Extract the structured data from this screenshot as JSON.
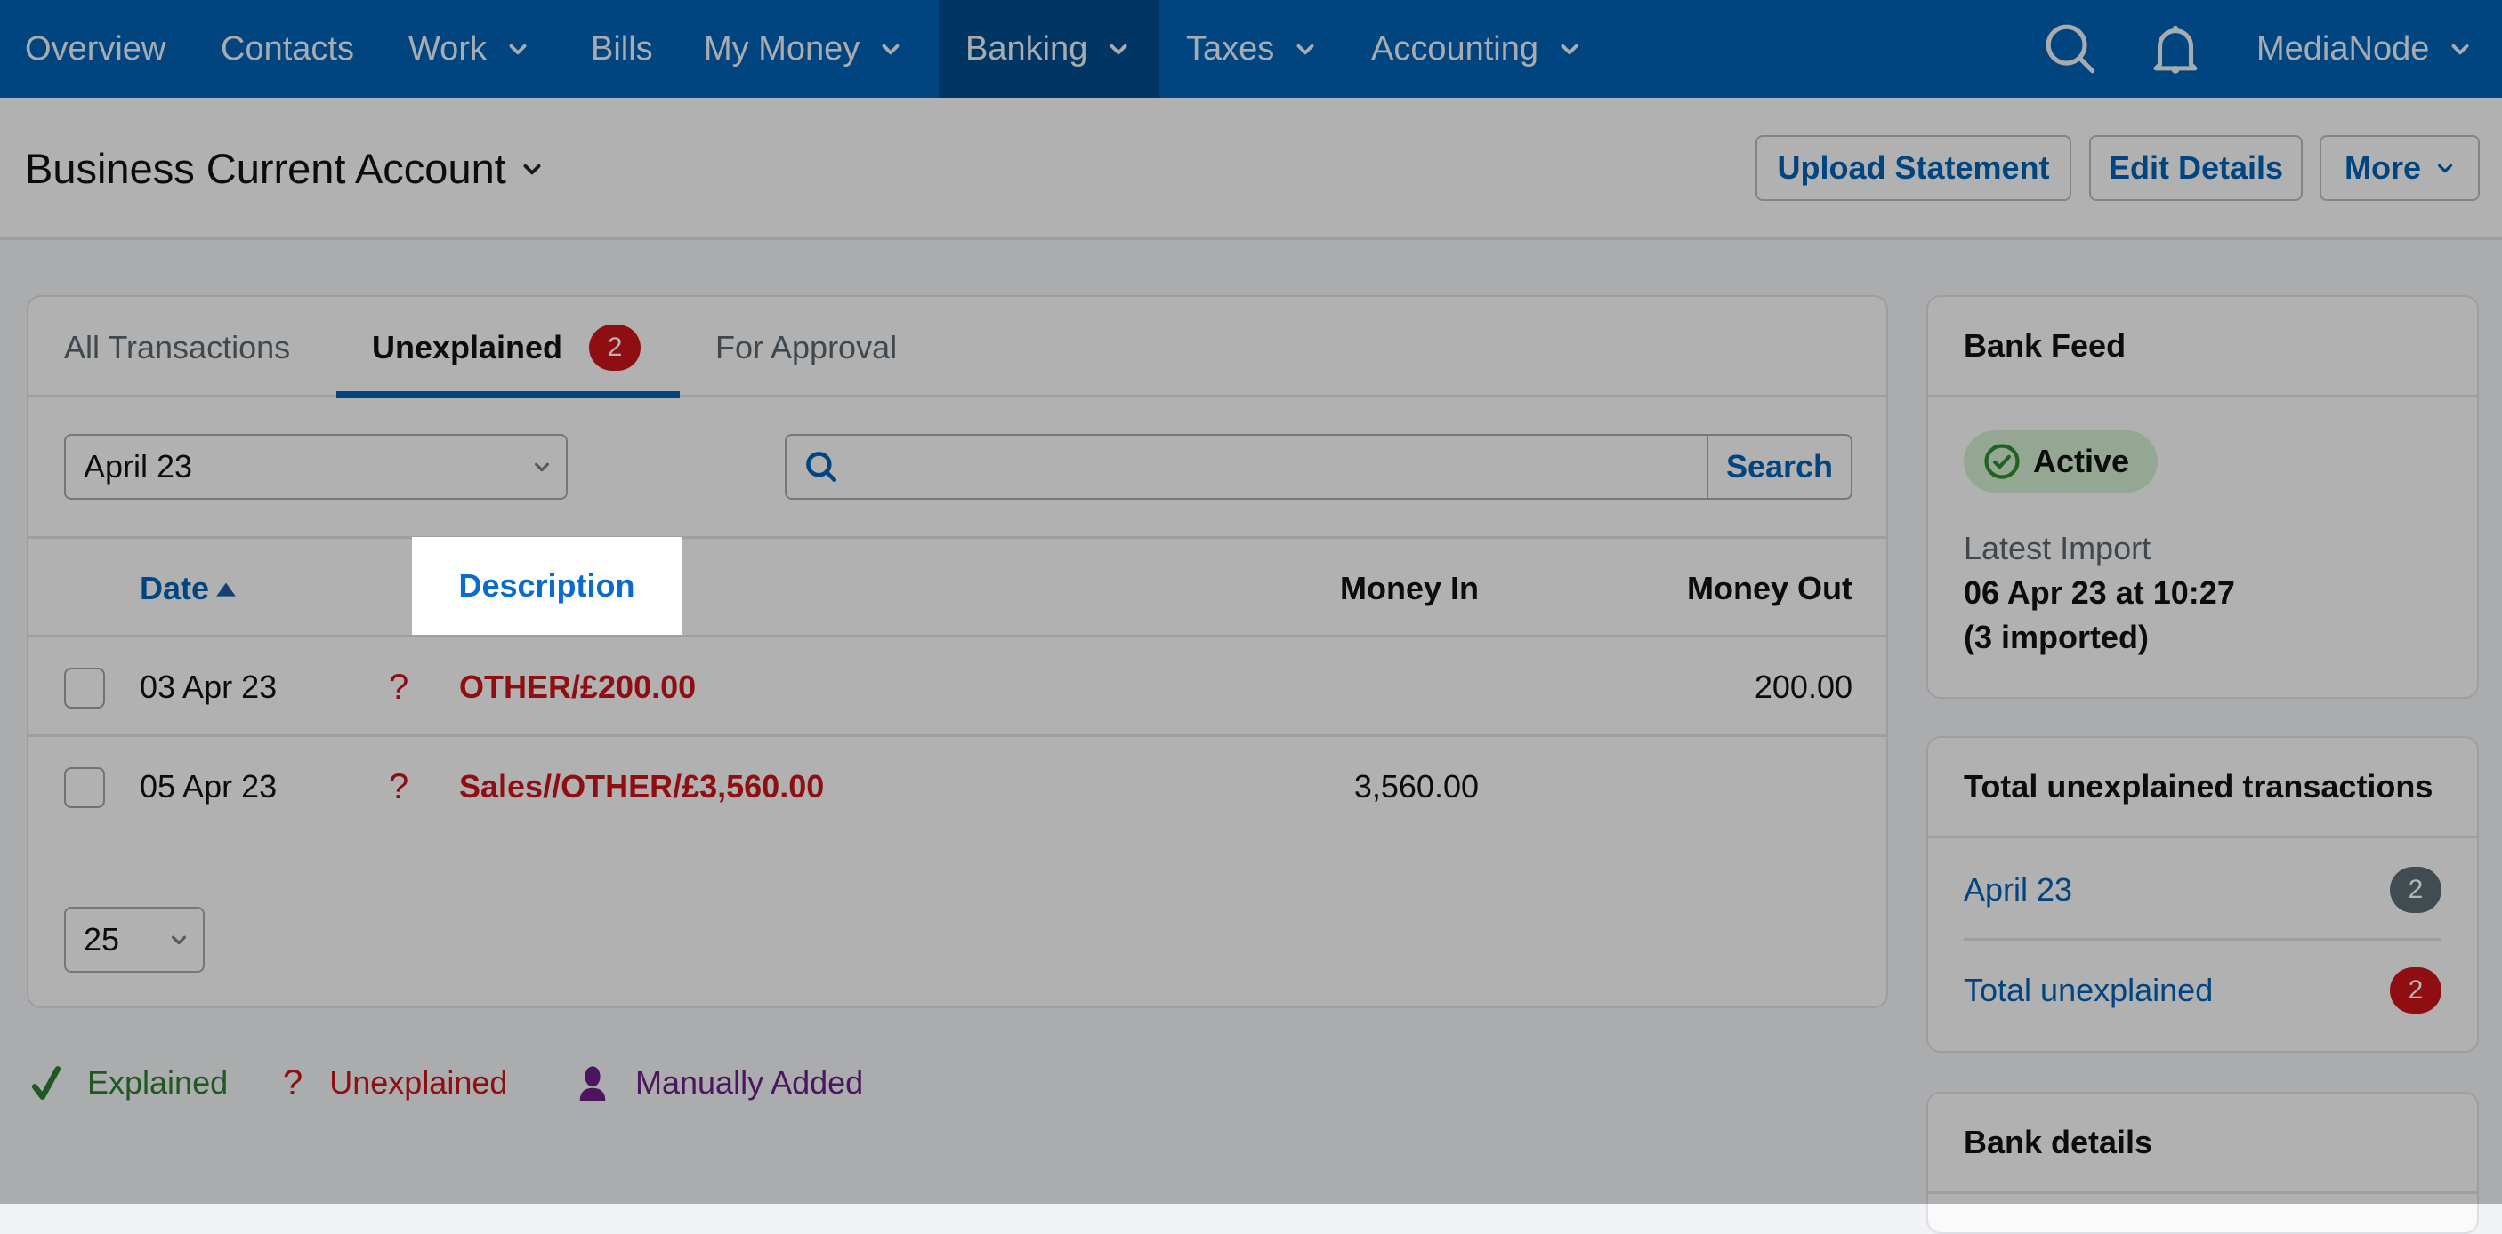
{
  "nav": {
    "items": [
      {
        "label": "Overview",
        "has_dropdown": false,
        "active": false
      },
      {
        "label": "Contacts",
        "has_dropdown": false,
        "active": false
      },
      {
        "label": "Work",
        "has_dropdown": true,
        "active": false
      },
      {
        "label": "Bills",
        "has_dropdown": false,
        "active": false
      },
      {
        "label": "My Money",
        "has_dropdown": true,
        "active": false
      },
      {
        "label": "Banking",
        "has_dropdown": true,
        "active": true
      },
      {
        "label": "Taxes",
        "has_dropdown": true,
        "active": false
      },
      {
        "label": "Accounting",
        "has_dropdown": true,
        "active": false
      }
    ],
    "icons": [
      "search-icon",
      "bell-icon"
    ],
    "account_label": "MediaNode"
  },
  "header": {
    "title": "Business Current Account",
    "buttons": {
      "upload": "Upload Statement",
      "edit": "Edit Details",
      "more": "More"
    }
  },
  "tabs": [
    {
      "label": "All Transactions",
      "active": false
    },
    {
      "label": "Unexplained",
      "active": true,
      "badge": "2"
    },
    {
      "label": "For Approval",
      "active": false
    }
  ],
  "filters": {
    "period_selected": "April 23",
    "search_value": "",
    "search_button": "Search"
  },
  "table": {
    "columns": {
      "date": "Date",
      "description": "Description",
      "money_in": "Money In",
      "money_out": "Money Out"
    },
    "sort": {
      "column": "date",
      "direction": "ascending"
    },
    "rows": [
      {
        "date": "03 Apr 23",
        "status": "?",
        "description": "OTHER/£200.00",
        "money_in": "",
        "money_out": "200.00"
      },
      {
        "date": "05 Apr 23",
        "status": "?",
        "description": "Sales//OTHER/£3,560.00",
        "money_in": "3,560.00",
        "money_out": ""
      }
    ],
    "per_page": "25"
  },
  "legend": {
    "explained": "Explained",
    "unexplained": "Unexplained",
    "manually_added": "Manually Added"
  },
  "sidebar": {
    "bank_feed": {
      "title": "Bank Feed",
      "status": "Active",
      "latest_import_label": "Latest Import",
      "latest_import_value": "06 Apr 23 at 10:27",
      "imported_count": "(3 imported)"
    },
    "unexplained": {
      "title": "Total unexplained transactions",
      "items": [
        {
          "label": "April 23",
          "count": "2"
        },
        {
          "label": "Total unexplained",
          "count": "2"
        }
      ]
    },
    "bank_details": {
      "title": "Bank details"
    }
  },
  "colors": {
    "brand": "#0060b5",
    "unexplained": "#c8141a",
    "explained": "#2e7d32",
    "manual": "#6a2085",
    "active_pill": "#d1ecd0"
  }
}
